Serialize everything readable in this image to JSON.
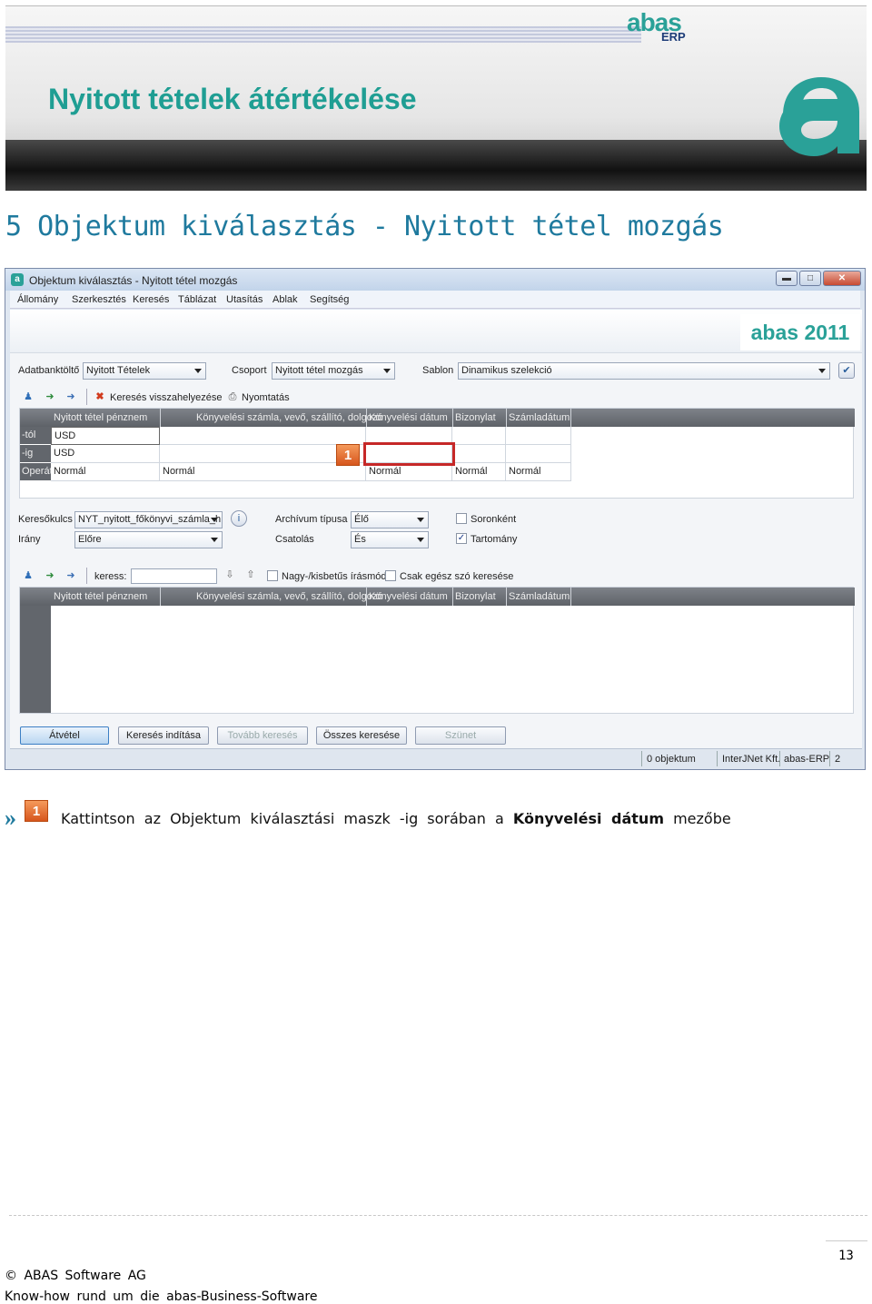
{
  "banner": {
    "title": "Nyitott tételek átértékelése",
    "logo_abas": "abas",
    "logo_erp": "ERP"
  },
  "section_title": "5 Objektum kiválasztás - Nyitott tétel mozgás",
  "window": {
    "title": "Objektum kiválasztás - Nyitott tétel mozgás",
    "controls": {
      "minimize": "▬",
      "maximize": "□",
      "close": "✕"
    },
    "menu": [
      "Állomány",
      "Szerkesztés",
      "Keresés",
      "Táblázat",
      "Utasítás",
      "Ablak",
      "Segítség"
    ],
    "brand_year": "abas 2011",
    "filters": {
      "database_label": "Adatbanktöltő",
      "database_value": "Nyitott Tételek",
      "group_label": "Csoport",
      "group_value": "Nyitott tétel mozgás",
      "template_label": "Sablon",
      "template_value": "Dinamikus szelekció"
    },
    "toolbar1": {
      "reset_search": "Keresés visszahelyezése",
      "print": "Nyomtatás"
    },
    "criteria_grid": {
      "columns": [
        "Nyitott tétel pénznem",
        "Könyvelési számla, vevő, szállító, dolgozó",
        "Könyvelési dátum",
        "Bizonylat",
        "Számladátum"
      ],
      "rows": [
        {
          "head": "-tól",
          "cells": [
            "USD",
            "",
            "",
            "",
            ""
          ]
        },
        {
          "head": "-ig",
          "cells": [
            "USD",
            "",
            "",
            "",
            ""
          ]
        },
        {
          "head": "Operát",
          "cells": [
            "Normál",
            "Normál",
            "Normál",
            "Normál",
            "Normál"
          ]
        }
      ]
    },
    "badge": "1",
    "search_opts": {
      "key_label": "Keresőkulcs",
      "key_value": "NYT_nyitott_főkönyvi_számla_h",
      "direction_label": "Irány",
      "direction_value": "Előre",
      "archive_label": "Archívum típusa",
      "archive_value": "Élő",
      "link_label": "Csatolás",
      "link_value": "És",
      "row_by_row": "Soronként",
      "range": "Tartomány"
    },
    "toolbar2": {
      "search_label": "keress:",
      "case_sensitive": "Nagy-/kisbetűs írásmód",
      "whole_word": "Csak egész szó keresése"
    },
    "result_grid": {
      "columns": [
        "Nyitott tétel pénznem",
        "Könyvelési számla, vevő, szállító, dolgozó",
        "Könyvelési dátum",
        "Bizonylat",
        "Számladátum"
      ]
    },
    "buttons": {
      "accept": "Átvétel",
      "start_search": "Keresés indítása",
      "continue_search": "Tovább keresés",
      "all_search": "Összes keresése",
      "pause": "Szünet"
    },
    "status": {
      "count": "0 objektum",
      "company": "InterJNet Kft.",
      "app": "abas-ERP",
      "num": "2"
    }
  },
  "instruction": {
    "badge": "1",
    "text_before": "Kattintson az Objektum kiválasztási maszk -ig sorában a",
    "bold": "Könyvelési dátum",
    "text_after": "mezőbe"
  },
  "footer": {
    "page": "13",
    "copyright": "© ABAS Software AG",
    "tagline": "Know-how rund um die abas-Business-Software"
  }
}
